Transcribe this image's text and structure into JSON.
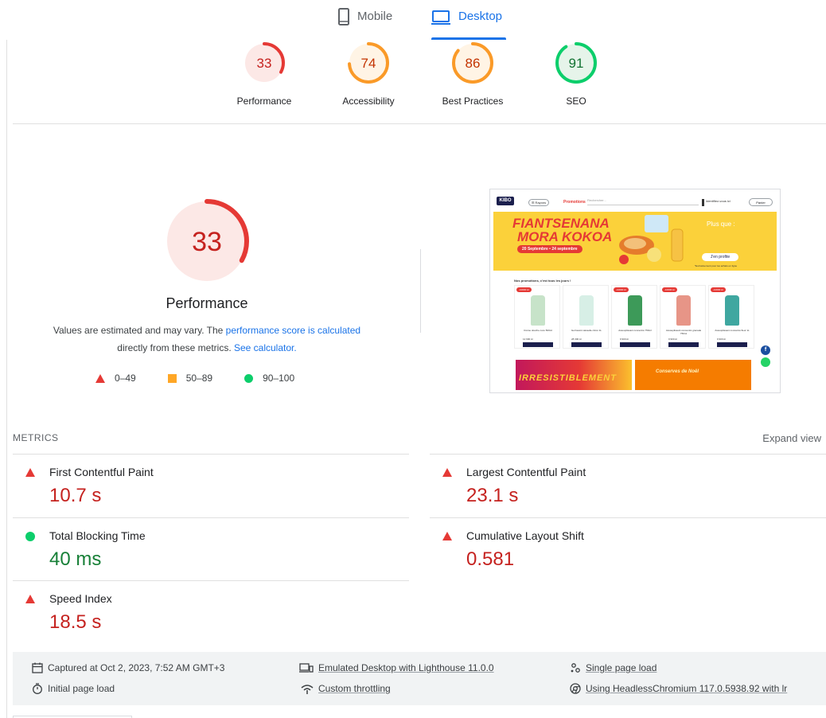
{
  "tabs": {
    "mobile_label": "Mobile",
    "desktop_label": "Desktop",
    "active": "Desktop"
  },
  "summary": [
    {
      "score": "33",
      "label": "Performance",
      "fraction": 0.33,
      "color": "#e53935",
      "bg": "#fce8e6"
    },
    {
      "score": "74",
      "label": "Accessibility",
      "fraction": 0.74,
      "color": "#fa9a28",
      "bg": "#fff4e5"
    },
    {
      "score": "86",
      "label": "Best Practices",
      "fraction": 0.86,
      "color": "#fa9a28",
      "bg": "#fff4e5"
    },
    {
      "score": "91",
      "label": "SEO",
      "fraction": 0.91,
      "color": "#0cce6b",
      "bg": "#e6f4ea"
    }
  ],
  "performance": {
    "score": "33",
    "fraction": 0.33,
    "title": "Performance",
    "desc_prefix": "Values are estimated and may vary. The ",
    "desc_link1": "performance score is calculated",
    "desc_mid": "directly from these metrics. ",
    "desc_link2": "See calculator.",
    "legend": [
      "0–49",
      "50–89",
      "90–100"
    ]
  },
  "thumbnail": {
    "logo": "KIBO",
    "menu_btn": "☰ Rayons",
    "promo": "Promotions",
    "search": "Rechercher...",
    "login": "Identifiez-vous ici",
    "cart": "Panier",
    "banner_title_1": "FIANTSENANA",
    "banner_title_2": "MORA KOKOA",
    "banner_date": "20 Septembre • 24 septembre",
    "banner_plus": "Plus que :",
    "banner_btn": "J'en profite",
    "banner_note": "*Exclusivement pour les achats en ligne",
    "promo_heading": "Nos promotions, c'est tous les jours !",
    "products": [
      {
        "tag": "-10000 Ar",
        "name": "Crème douche coco 500ml",
        "price": "12 900 Ar",
        "color": "#c7e3c9"
      },
      {
        "tag": "",
        "name": "Gel lavant vaisselle citron 1L",
        "price": "28 300 Ar",
        "color": "#d7efe6"
      },
      {
        "tag": "-10000 Ar",
        "name": "Assouplissant concentré 750ml",
        "price": "9 900 Ar",
        "color": "#3d9a59"
      },
      {
        "tag": "-10000 Ar",
        "name": "Assouplissant concentré grenade 750ml",
        "price": "9 900 Ar",
        "color": "#e79587"
      },
      {
        "tag": "-10000 Ar",
        "name": "Assouplissant concentré fleur 1L",
        "price": "9 900 Ar",
        "color": "#3fa7a0"
      }
    ],
    "banner2_left": "IRRESISTIBLEMENT",
    "banner2_right": "Conserves de Noël"
  },
  "metrics": {
    "header": "METRICS",
    "expand": "Expand view",
    "items": [
      {
        "name": "First Contentful Paint",
        "value": "10.7 s",
        "status": "fail"
      },
      {
        "name": "Largest Contentful Paint",
        "value": "23.1 s",
        "status": "fail"
      },
      {
        "name": "Total Blocking Time",
        "value": "40 ms",
        "status": "pass"
      },
      {
        "name": "Cumulative Layout Shift",
        "value": "0.581",
        "status": "fail"
      },
      {
        "name": "Speed Index",
        "value": "18.5 s",
        "status": "fail"
      }
    ]
  },
  "info": {
    "captured": "Captured at Oct 2, 2023, 7:52 AM GMT+3",
    "initial": "Initial page load",
    "emulated": "Emulated Desktop with Lighthouse 11.0.0",
    "throttling": "Custom throttling",
    "single": "Single page load",
    "headless": "Using HeadlessChromium 117.0.5938.92 with lr"
  },
  "icons": {
    "mobile": "phone-icon",
    "desktop": "laptop-icon",
    "calendar": "calendar-icon",
    "timer": "timer-icon",
    "device": "devices-icon",
    "wifi": "wifi-icon",
    "people": "nodes-icon",
    "browser": "chrome-icon"
  }
}
